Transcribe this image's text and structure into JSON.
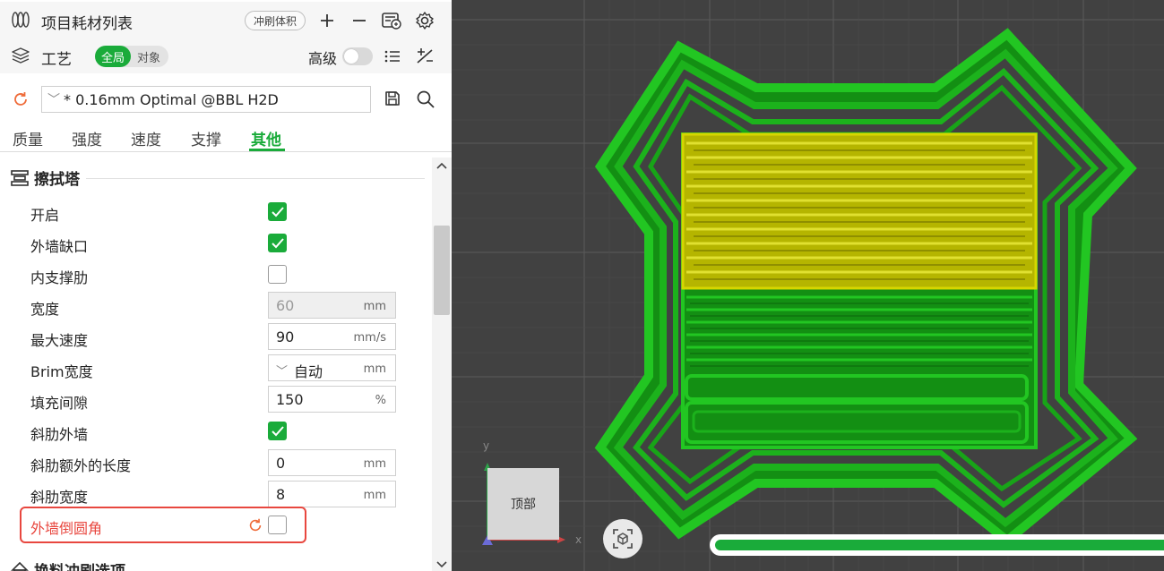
{
  "filament": {
    "title": "项目耗材列表",
    "flush_volume_label": "冲刷体积"
  },
  "process": {
    "title": "工艺",
    "scope_global": "全局",
    "scope_object": "对象",
    "advanced_label": "高级"
  },
  "preset": {
    "name": "* 0.16mm Optimal @BBL H2D"
  },
  "tabs": [
    {
      "label": "质量"
    },
    {
      "label": "强度"
    },
    {
      "label": "速度"
    },
    {
      "label": "支撑"
    },
    {
      "label": "其他",
      "active": true
    }
  ],
  "section": {
    "title": "擦拭塔",
    "next_title": "换料冲刷选项"
  },
  "options": {
    "enable": {
      "label": "开启",
      "checked": true
    },
    "outer_wall_gap": {
      "label": "外墙缺口",
      "checked": true
    },
    "inner_rib": {
      "label": "内支撑肋",
      "checked": false
    },
    "width": {
      "label": "宽度",
      "value": "60",
      "unit": "mm"
    },
    "max_speed": {
      "label": "最大速度",
      "value": "90",
      "unit": "mm/s"
    },
    "brim_width": {
      "label": "Brim宽度",
      "value": "自动",
      "unit": "mm"
    },
    "infill_gap": {
      "label": "填充间隙",
      "value": "150",
      "unit": "%"
    },
    "rib_wall": {
      "label": "斜肋外墙",
      "checked": true
    },
    "rib_extra_length": {
      "label": "斜肋额外的长度",
      "value": "0",
      "unit": "mm"
    },
    "rib_width": {
      "label": "斜肋宽度",
      "value": "8",
      "unit": "mm"
    },
    "fillet_wall": {
      "label": "外墙倒圆角",
      "checked": false
    }
  },
  "viewport": {
    "view_label": "顶部",
    "axis_x": "x",
    "axis_y": "y",
    "progress_fraction": 1.0
  },
  "colors": {
    "accent": "#1aab3a",
    "highlight": "#e8473f",
    "tower_green": "#1cb21c",
    "tower_yellow": "#c8c800",
    "viewport_bg": "#414141"
  }
}
